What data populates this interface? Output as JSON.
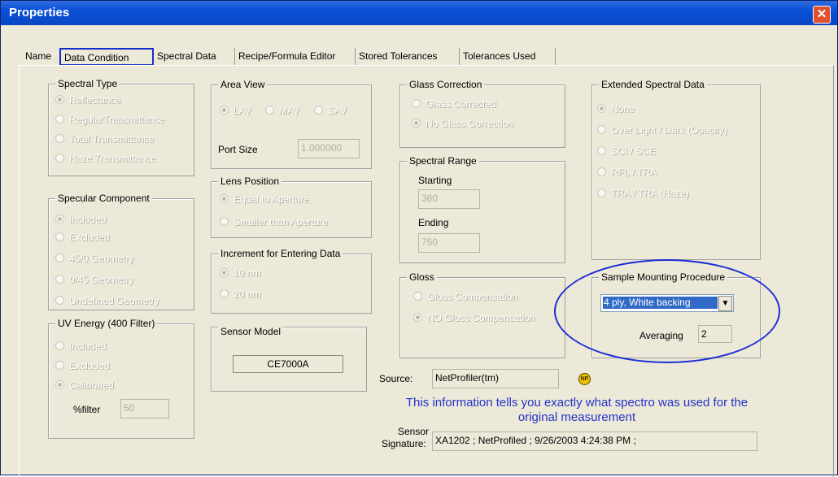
{
  "window": {
    "title": "Properties",
    "close_icon": "close-icon"
  },
  "tabs": [
    "Name",
    "Data Condition",
    "Spectral Data",
    "Recipe/Formula Editor",
    "Stored Tolerances",
    "Tolerances Used"
  ],
  "spectral_type": {
    "title": "Spectral Type",
    "options": [
      "Reflectance",
      "RegularTransmittance",
      "Total Transmittance",
      "Haze Transmittance"
    ],
    "selected": "Reflectance"
  },
  "specular": {
    "title": "Specular Component",
    "options": [
      "Included",
      "Excluded",
      "45/0 Geometry",
      "0/45 Geometry",
      "Undefined Geometry"
    ],
    "selected": "Included"
  },
  "uv": {
    "title": "UV Energy (400 Filter)",
    "options": [
      "Included",
      "Excluded",
      "Calibrated"
    ],
    "selected": "Calibrated",
    "filter_label": "%filter",
    "filter_value": "50"
  },
  "area_view": {
    "title": "Area View",
    "options": [
      "LAV",
      "MAV",
      "SAV"
    ],
    "selected": "LAV",
    "port_label": "Port Size",
    "port_value": "1.000000"
  },
  "lens": {
    "title": "Lens Position",
    "options": [
      "Equal to Aperture",
      "Smaller than Aperture"
    ],
    "selected": "Equal to Aperture"
  },
  "increment": {
    "title": "Increment for Entering Data",
    "options": [
      "10 nm",
      "20 nm"
    ],
    "selected": "10 nm"
  },
  "sensor": {
    "title": "Sensor Model",
    "value": "CE7000A"
  },
  "glass": {
    "title": "Glass Correction",
    "options": [
      "Glass Corrected",
      "No Glass Correction"
    ],
    "selected": "No Glass Correction"
  },
  "range": {
    "title": "Spectral Range",
    "start_label": "Starting",
    "start_value": "360",
    "end_label": "Ending",
    "end_value": "750"
  },
  "gloss": {
    "title": "Gloss",
    "options": [
      "Gloss Compensation",
      "NO Gloss Compensation"
    ],
    "selected": "NO Gloss Compensation"
  },
  "extended": {
    "title": "Extended Spectral Data",
    "options": [
      "None",
      "Over Light / Dark (Opacity)",
      "SCI / SCE",
      "RFL / TRA",
      "TRA / TRA (Haze)"
    ],
    "selected": "None"
  },
  "mounting": {
    "title": "Sample Mounting Procedure",
    "value": "4 ply,  White backing",
    "avg_label": "Averaging",
    "avg_value": "2"
  },
  "source": {
    "label": "Source:",
    "value": "NetProfiler(tm)",
    "icon_text": "NP"
  },
  "note": "This information tells you exactly what spectro was used for the original measurement",
  "signature": {
    "label1": "Sensor",
    "label2": "Signature:",
    "value": "XA1202 ; NetProfiled ; 9/26/2003 4:24:38 PM ;"
  },
  "colors": {
    "title_bar": "#0a51d6",
    "annotation": "#1d2ed6",
    "dialog_bg": "#ece9d8"
  }
}
